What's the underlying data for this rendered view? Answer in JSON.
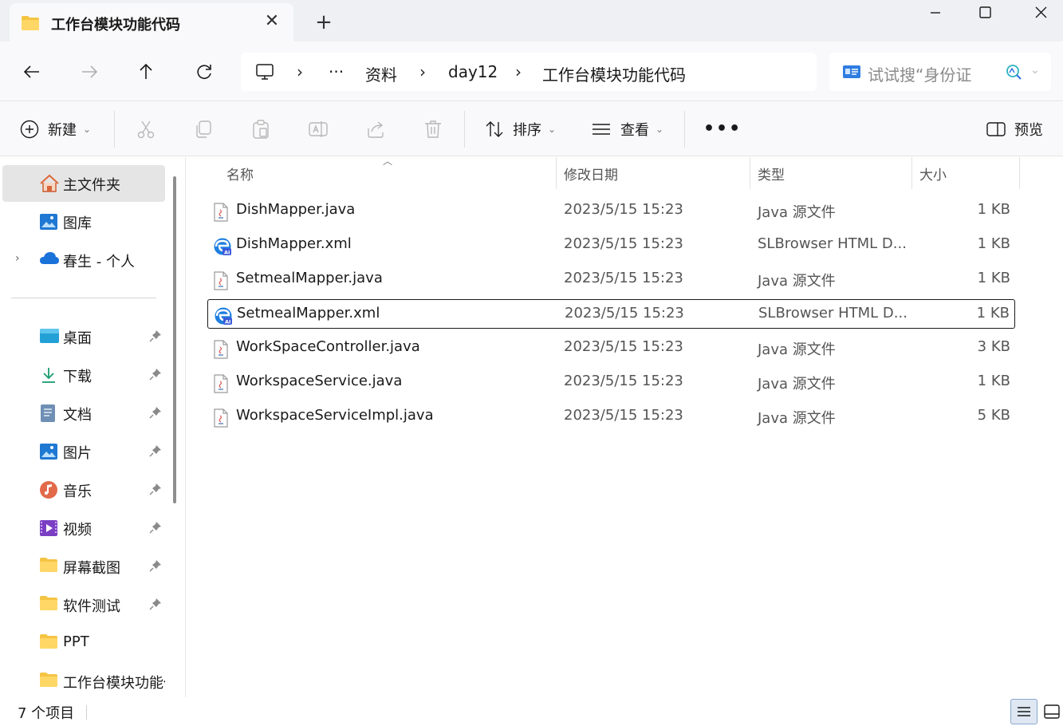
{
  "tab": {
    "title": "工作台模块功能代码",
    "close": "✕",
    "new_tab": "+"
  },
  "window": {
    "minimize": "—",
    "maximize": "☐",
    "close": "✕"
  },
  "breadcrumbs": {
    "overflow": "···",
    "items": [
      "资料",
      "day12",
      "工作台模块功能代码"
    ],
    "separator": "›"
  },
  "search": {
    "placeholder": "试试搜“身份证"
  },
  "toolbar": {
    "new_label": "新建",
    "sort_label": "排序",
    "view_label": "查看",
    "more": "•••",
    "preview_label": "预览"
  },
  "sidebar": {
    "home": "主文件夹",
    "gallery": "图库",
    "onedrive": "春生 - 个人",
    "quick_access": [
      {
        "label": "桌面"
      },
      {
        "label": "下载"
      },
      {
        "label": "文档"
      },
      {
        "label": "图片"
      },
      {
        "label": "音乐"
      },
      {
        "label": "视频"
      },
      {
        "label": "屏幕截图"
      },
      {
        "label": "软件测试"
      },
      {
        "label": "PPT"
      },
      {
        "label": "工作台模块功能代码"
      }
    ]
  },
  "columns": {
    "name": "名称",
    "modified": "修改日期",
    "type": "类型",
    "size": "大小"
  },
  "files": [
    {
      "name": "DishMapper.java",
      "modified": "2023/5/15 15:23",
      "type": "Java 源文件",
      "size": "1 KB",
      "icon": "java-file-icon"
    },
    {
      "name": "DishMapper.xml",
      "modified": "2023/5/15 15:23",
      "type": "SLBrowser HTML D...",
      "size": "1 KB",
      "icon": "browser-file-icon"
    },
    {
      "name": "SetmealMapper.java",
      "modified": "2023/5/15 15:23",
      "type": "Java 源文件",
      "size": "1 KB",
      "icon": "java-file-icon"
    },
    {
      "name": "SetmealMapper.xml",
      "modified": "2023/5/15 15:23",
      "type": "SLBrowser HTML D...",
      "size": "1 KB",
      "icon": "browser-file-icon",
      "selected": true
    },
    {
      "name": "WorkSpaceController.java",
      "modified": "2023/5/15 15:23",
      "type": "Java 源文件",
      "size": "3 KB",
      "icon": "java-file-icon"
    },
    {
      "name": "WorkspaceService.java",
      "modified": "2023/5/15 15:23",
      "type": "Java 源文件",
      "size": "1 KB",
      "icon": "java-file-icon"
    },
    {
      "name": "WorkspaceServiceImpl.java",
      "modified": "2023/5/15 15:23",
      "type": "Java 源文件",
      "size": "5 KB",
      "icon": "java-file-icon"
    }
  ],
  "status": {
    "item_count": "7 个项目"
  },
  "colors": {
    "accent": "#0067c0",
    "folder": "#f4c443",
    "selection_bg": "#e5e5e5"
  }
}
